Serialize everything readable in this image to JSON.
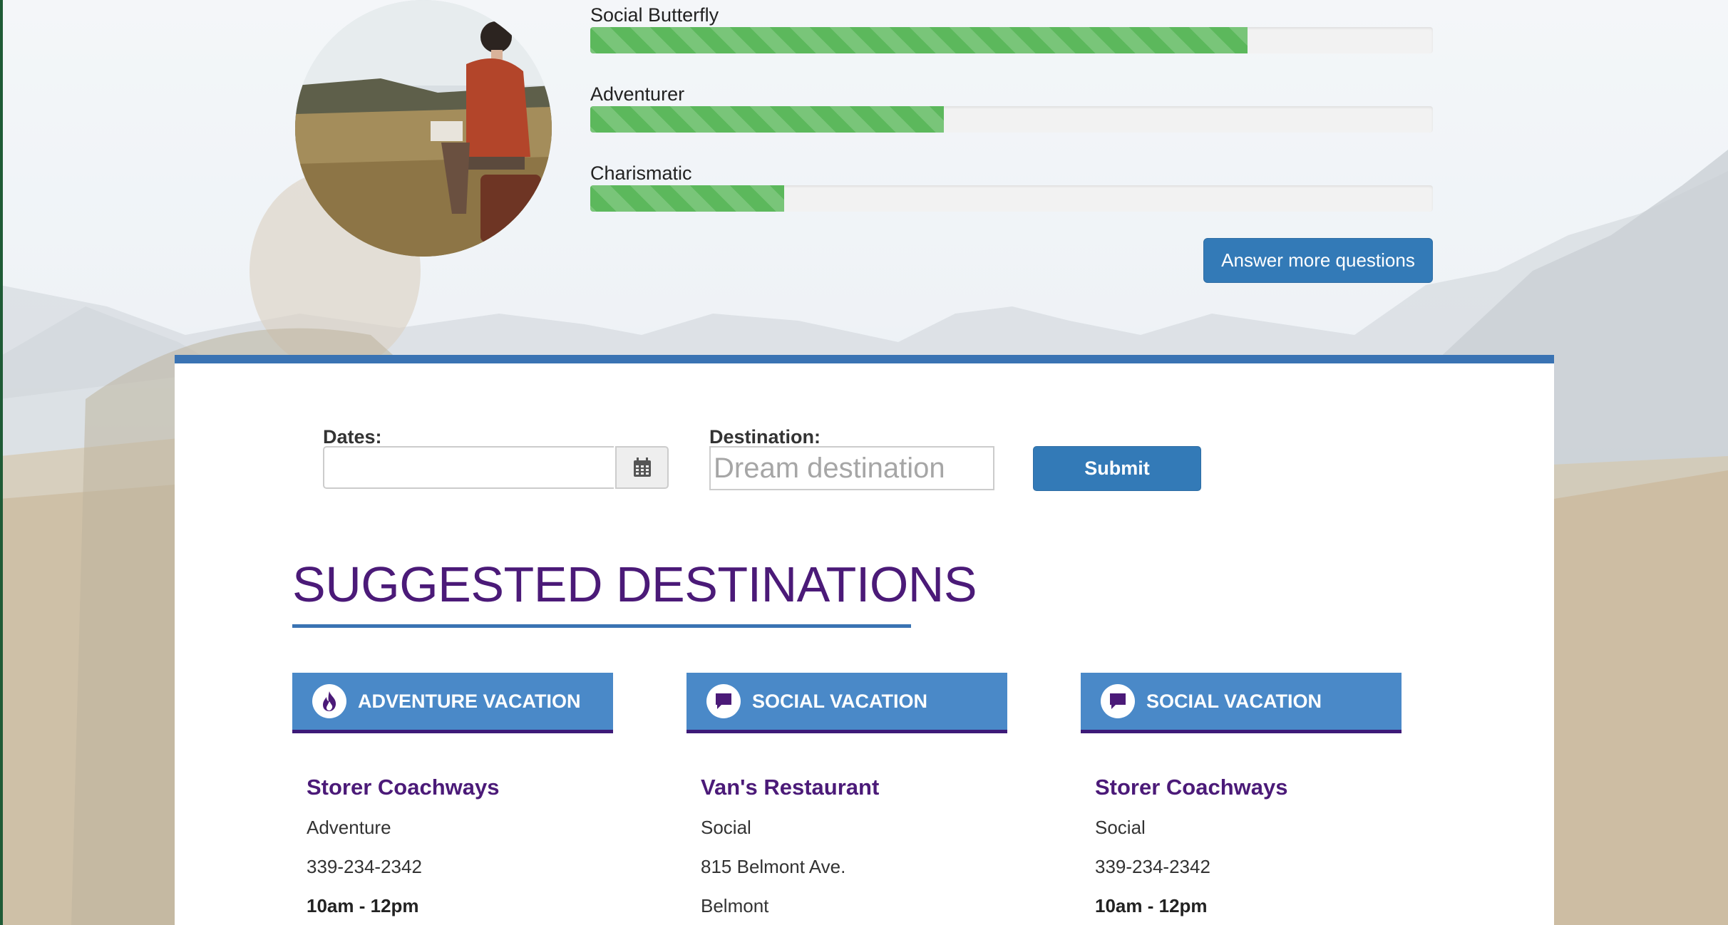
{
  "profile": {
    "skills": [
      {
        "label": "Social Butterfly",
        "percent": 78
      },
      {
        "label": "Adventurer",
        "percent": 42
      },
      {
        "label": "Charismatic",
        "percent": 23
      }
    ],
    "answer_button_label": "Answer more questions"
  },
  "search": {
    "dates_label": "Dates:",
    "dates_value": "",
    "destination_label": "Destination:",
    "destination_placeholder": "Dream destination",
    "destination_value": "",
    "submit_label": "Submit"
  },
  "suggested": {
    "title": "SUGGESTED DESTINATIONS",
    "items": [
      {
        "category": "ADVENTURE VACATION",
        "icon": "flame-icon",
        "name": "Storer Coachways",
        "line1": "Adventure",
        "line2": "339-234-2342",
        "line3": "10am - 12pm",
        "line3_bold": true
      },
      {
        "category": "SOCIAL VACATION",
        "icon": "chat-bubble-icon",
        "name": "Van's Restaurant",
        "line1": "Social",
        "line2": "815 Belmont Ave.",
        "line3": "Belmont",
        "line3_bold": false
      },
      {
        "category": "SOCIAL VACATION",
        "icon": "chat-bubble-icon",
        "name": "Storer Coachways",
        "line1": "Social",
        "line2": "339-234-2342",
        "line3": "10am - 12pm",
        "line3_bold": true
      }
    ]
  },
  "colors": {
    "accent_blue": "#3a73b3",
    "purple": "#4b1a78",
    "progress_green": "#5cb85c",
    "button_blue": "#337ab7"
  }
}
